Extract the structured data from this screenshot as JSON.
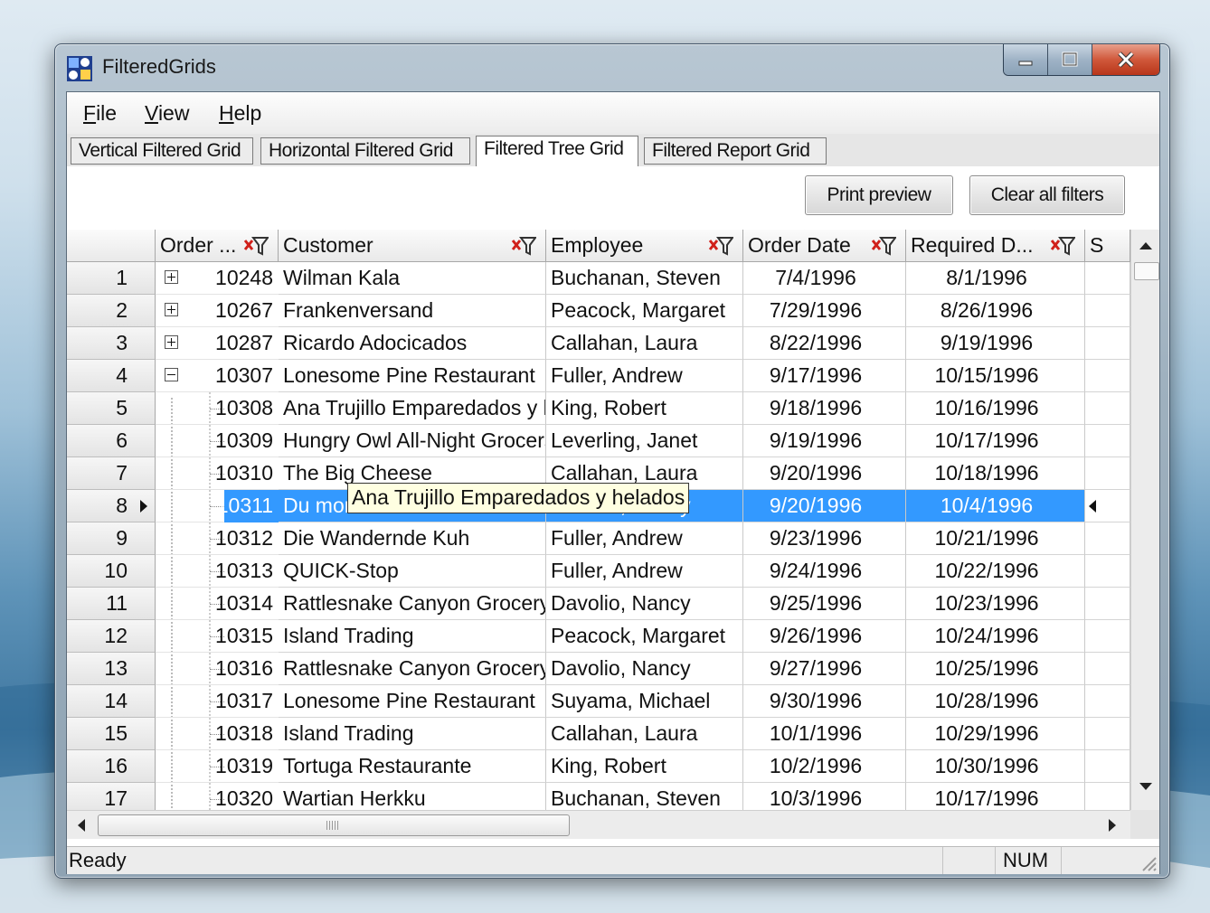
{
  "window": {
    "title": "FilteredGrids"
  },
  "menu": [
    {
      "underline": "F",
      "rest": "ile"
    },
    {
      "underline": "V",
      "rest": "iew"
    },
    {
      "underline": "H",
      "rest": "elp"
    }
  ],
  "tabs": [
    {
      "label": "Vertical Filtered Grid",
      "active": false
    },
    {
      "label": "Horizontal Filtered Grid",
      "active": false
    },
    {
      "label": "Filtered Tree Grid",
      "active": true
    },
    {
      "label": "Filtered Report Grid",
      "active": false
    }
  ],
  "toolbar": {
    "print_preview": "Print preview",
    "clear_filters": "Clear all filters"
  },
  "columns": [
    {
      "label": "Order ...",
      "filter_icon": "filter-clear-icon"
    },
    {
      "label": "Customer",
      "filter_icon": "filter-clear-icon"
    },
    {
      "label": "Employee",
      "filter_icon": "filter-clear-icon"
    },
    {
      "label": "Order Date",
      "filter_icon": "filter-clear-icon"
    },
    {
      "label": "Required D...",
      "filter_icon": "filter-clear-icon"
    },
    {
      "label": "S"
    }
  ],
  "rows": [
    {
      "num": "1",
      "expander": "plus",
      "order": "10248",
      "customer": "Wilman Kala",
      "employee": "Buchanan, Steven",
      "order_date": "7/4/1996",
      "required": "8/1/1996"
    },
    {
      "num": "2",
      "expander": "plus",
      "order": "10267",
      "customer": "Frankenversand",
      "employee": "Peacock, Margaret",
      "order_date": "7/29/1996",
      "required": "8/26/1996"
    },
    {
      "num": "3",
      "expander": "plus",
      "order": "10287",
      "customer": "Ricardo Adocicados",
      "employee": "Callahan, Laura",
      "order_date": "8/22/1996",
      "required": "9/19/1996"
    },
    {
      "num": "4",
      "expander": "minus",
      "order": "10307",
      "customer": "Lonesome Pine Restaurant",
      "employee": "Fuller, Andrew",
      "order_date": "9/17/1996",
      "required": "10/15/1996"
    },
    {
      "num": "5",
      "order": "10308",
      "customer": "Ana Trujillo Emparedados y helados",
      "employee": "King, Robert",
      "order_date": "9/18/1996",
      "required": "10/16/1996"
    },
    {
      "num": "6",
      "order": "10309",
      "customer": "Hungry Owl All-Night Grocers",
      "employee": "Leverling, Janet",
      "order_date": "9/19/1996",
      "required": "10/17/1996"
    },
    {
      "num": "7",
      "order": "10310",
      "customer": "The Big Cheese",
      "employee": "Callahan, Laura",
      "order_date": "9/20/1996",
      "required": "10/18/1996"
    },
    {
      "num": "8",
      "order": "10311",
      "customer": "Du monde entier",
      "employee": "Davolio, Nancy",
      "order_date": "9/20/1996",
      "required": "10/4/1996",
      "selected": true
    },
    {
      "num": "9",
      "order": "10312",
      "customer": "Die Wandernde Kuh",
      "employee": "Fuller, Andrew",
      "order_date": "9/23/1996",
      "required": "10/21/1996"
    },
    {
      "num": "10",
      "order": "10313",
      "customer": "QUICK-Stop",
      "employee": "Fuller, Andrew",
      "order_date": "9/24/1996",
      "required": "10/22/1996"
    },
    {
      "num": "11",
      "order": "10314",
      "customer": "Rattlesnake Canyon Grocery",
      "employee": "Davolio, Nancy",
      "order_date": "9/25/1996",
      "required": "10/23/1996"
    },
    {
      "num": "12",
      "order": "10315",
      "customer": "Island Trading",
      "employee": "Peacock, Margaret",
      "order_date": "9/26/1996",
      "required": "10/24/1996"
    },
    {
      "num": "13",
      "order": "10316",
      "customer": "Rattlesnake Canyon Grocery",
      "employee": "Davolio, Nancy",
      "order_date": "9/27/1996",
      "required": "10/25/1996"
    },
    {
      "num": "14",
      "order": "10317",
      "customer": "Lonesome Pine Restaurant",
      "employee": "Suyama, Michael",
      "order_date": "9/30/1996",
      "required": "10/28/1996"
    },
    {
      "num": "15",
      "order": "10318",
      "customer": "Island Trading",
      "employee": "Callahan, Laura",
      "order_date": "10/1/1996",
      "required": "10/29/1996"
    },
    {
      "num": "16",
      "order": "10319",
      "customer": "Tortuga Restaurante",
      "employee": "King, Robert",
      "order_date": "10/2/1996",
      "required": "10/30/1996"
    },
    {
      "num": "17",
      "order": "10320",
      "customer": "Wartian Herkku",
      "employee": "Buchanan, Steven",
      "order_date": "10/3/1996",
      "required": "10/17/1996"
    }
  ],
  "tooltip": {
    "text": "Ana Trujillo Emparedados y helados"
  },
  "status": {
    "text": "Ready",
    "num": "NUM"
  },
  "colors": {
    "selection": "#3399ff",
    "close_button": "#c8472a"
  }
}
